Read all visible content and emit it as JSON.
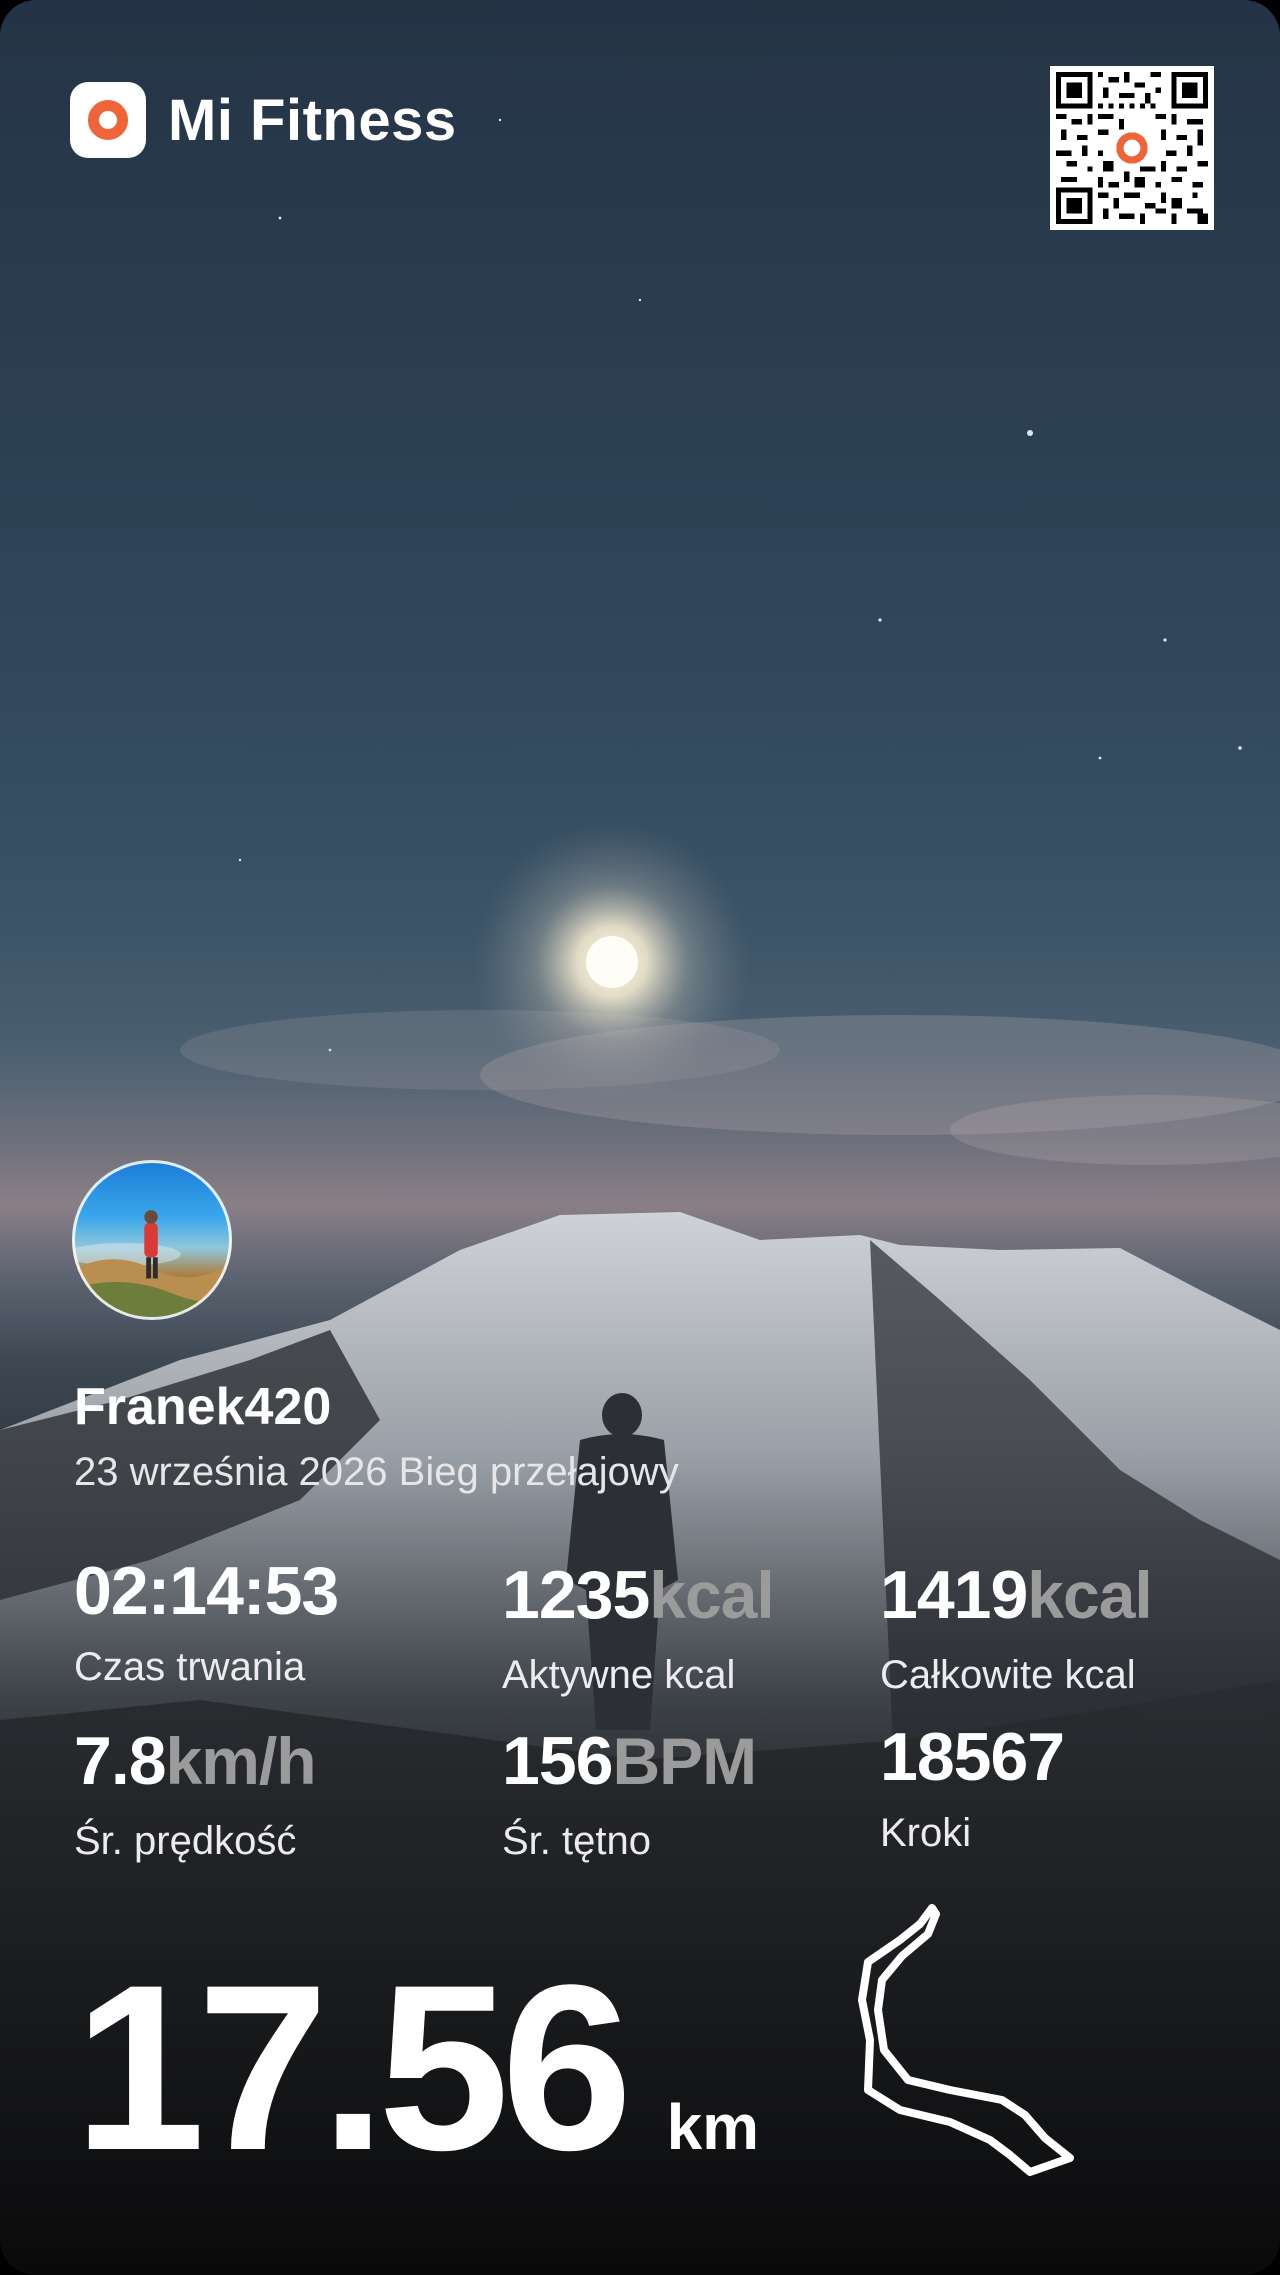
{
  "brand": {
    "name": "Mi Fitness",
    "logo_icon": "mi-fitness-logo-icon",
    "accent": "#f0643a"
  },
  "qr": {
    "icon": "qr-code-icon"
  },
  "profile": {
    "username": "Franek420",
    "subtitle": "23 września 2026 Bieg przełajowy"
  },
  "stats": {
    "duration": {
      "value": "02:14:53",
      "unit": "",
      "label": "Czas trwania"
    },
    "active_kcal": {
      "value": "1235",
      "unit": "kcal",
      "label": "Aktywne kcal"
    },
    "total_kcal": {
      "value": "1419",
      "unit": "kcal",
      "label": "Całkowite kcal"
    },
    "avg_speed": {
      "value": "7.8",
      "unit": "km/h",
      "label": "Śr. prędkość"
    },
    "avg_hr": {
      "value": "156",
      "unit": "BPM",
      "label": "Śr. tętno"
    },
    "steps": {
      "value": "18567",
      "unit": "",
      "label": "Kroki"
    }
  },
  "distance": {
    "value": "17.56",
    "unit": "km"
  },
  "route": {
    "icon": "route-map-icon"
  }
}
